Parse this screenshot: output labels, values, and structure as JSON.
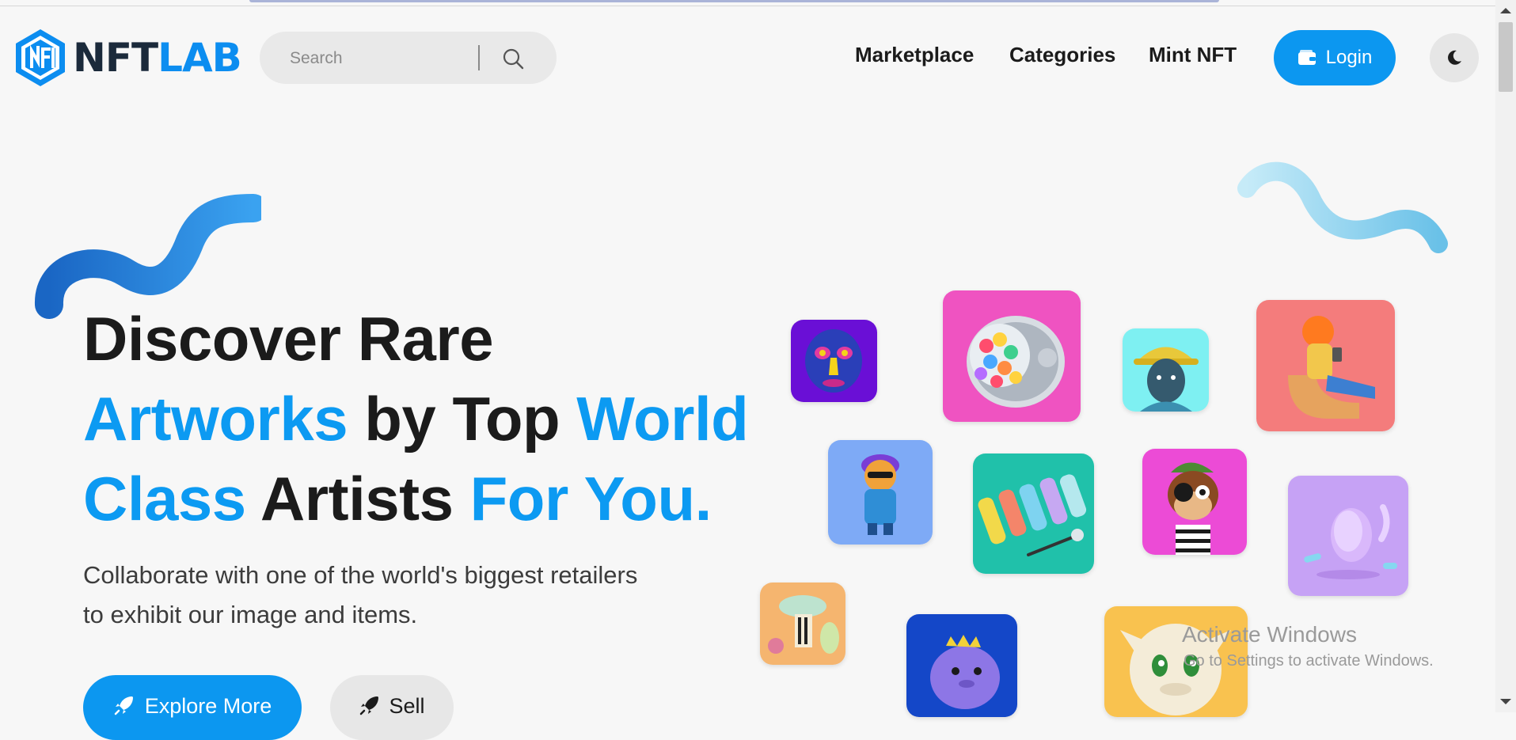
{
  "brand": {
    "name_part1": "NFT",
    "name_part2": "LAB",
    "logo_color": "#0c8df0"
  },
  "search": {
    "placeholder": "Search"
  },
  "nav": {
    "items": [
      "Marketplace",
      "Categories",
      "Mint NFT"
    ]
  },
  "login": {
    "label": "Login"
  },
  "theme_toggle": {
    "icon": "moon-icon"
  },
  "hero": {
    "line1": "Discover Rare",
    "line2_a": "Artworks",
    "line2_b": " by Top ",
    "line2_c": "World",
    "line3_a": "Class",
    "line3_b": " Artists ",
    "line3_c": "For You.",
    "subtitle_1": "Collaborate with one of the world's biggest retailers",
    "subtitle_2": "to exhibit our image and items."
  },
  "buttons": {
    "explore": "Explore More",
    "sell": "Sell"
  },
  "watermark": {
    "line1": "Activate Windows",
    "line2": "Go to Settings to activate Windows."
  },
  "colors": {
    "accent": "#0c97f0",
    "text": "#1b1b1b",
    "background": "#f7f7f7"
  }
}
